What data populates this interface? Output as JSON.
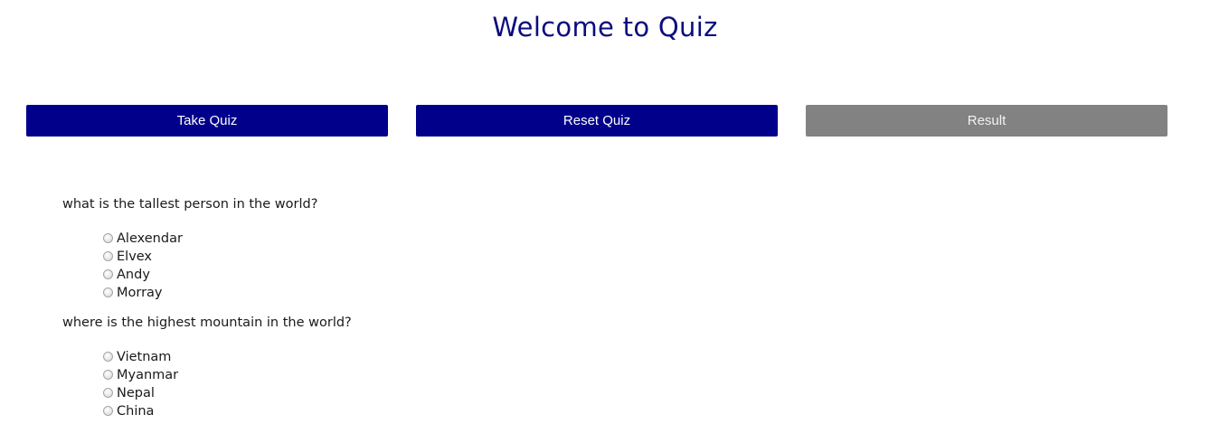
{
  "page": {
    "title": "Welcome to Quiz"
  },
  "toolbar": {
    "take_quiz_label": "Take Quiz",
    "reset_quiz_label": "Reset Quiz",
    "result_label": "Result"
  },
  "colors": {
    "title": "#0b0b80",
    "primary_button": "#00008b",
    "disabled_button": "#828282"
  },
  "questions": [
    {
      "text": "what is the tallest person in the world?",
      "options": [
        "Alexendar",
        "Elvex",
        "Andy",
        "Morray"
      ]
    },
    {
      "text": "where is the highest mountain in the world?",
      "options": [
        "Vietnam",
        "Myanmar",
        "Nepal",
        "China"
      ]
    }
  ]
}
